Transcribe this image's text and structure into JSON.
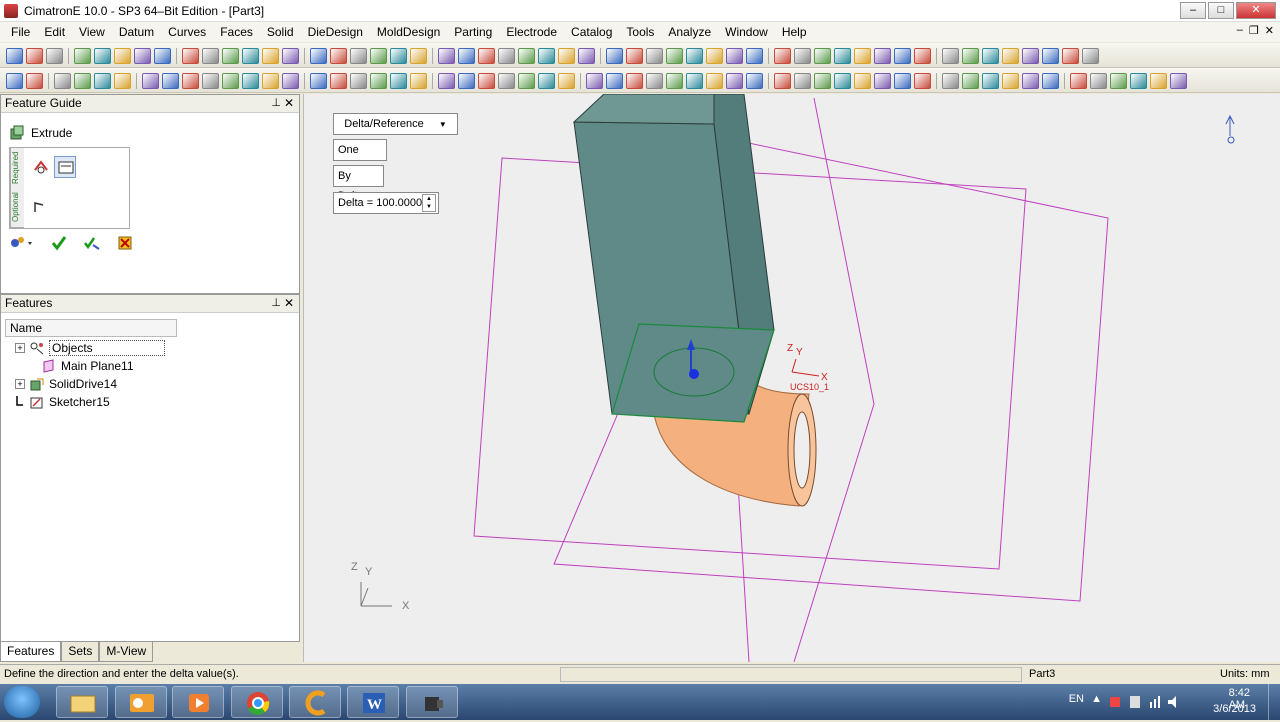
{
  "window": {
    "title": "CimatronE 10.0 - SP3 64–Bit Edition - [Part3]"
  },
  "menu": [
    "File",
    "Edit",
    "View",
    "Datum",
    "Curves",
    "Faces",
    "Solid",
    "DieDesign",
    "MoldDesign",
    "Parting",
    "Electrode",
    "Catalog",
    "Tools",
    "Analyze",
    "Window",
    "Help"
  ],
  "feature_guide": {
    "title": "Feature Guide",
    "feature_name": "Extrude",
    "tab_required": "Required",
    "tab_optional": "Optional"
  },
  "features_panel": {
    "title": "Features",
    "column": "Name",
    "items": [
      {
        "label": "Objects",
        "expandable": true
      },
      {
        "label": "Main Plane11",
        "expandable": false
      },
      {
        "label": "SolidDrive14",
        "expandable": true
      },
      {
        "label": "Sketcher15",
        "expandable": false
      }
    ]
  },
  "bottom_tabs": [
    "Features",
    "Sets",
    "M-View"
  ],
  "viewport": {
    "dropdown": "Delta/Reference",
    "side_button": "One Side",
    "mode_button": "By Delta",
    "delta_field": "Delta = 100.0000",
    "ucs_label": "UCS10_1",
    "axis_x": "X",
    "axis_y": "Y",
    "axis_z": "Z"
  },
  "status": {
    "prompt": "Define the direction and enter the delta value(s).",
    "part": "Part3",
    "units": "Units: mm"
  },
  "taskbar": {
    "lang": "EN",
    "time": "8:42 AM",
    "date": "3/6/2013"
  },
  "colors": {
    "solid_box": "#5f8a87",
    "pipe": "#f4b07e",
    "plane": "#c040c0"
  }
}
